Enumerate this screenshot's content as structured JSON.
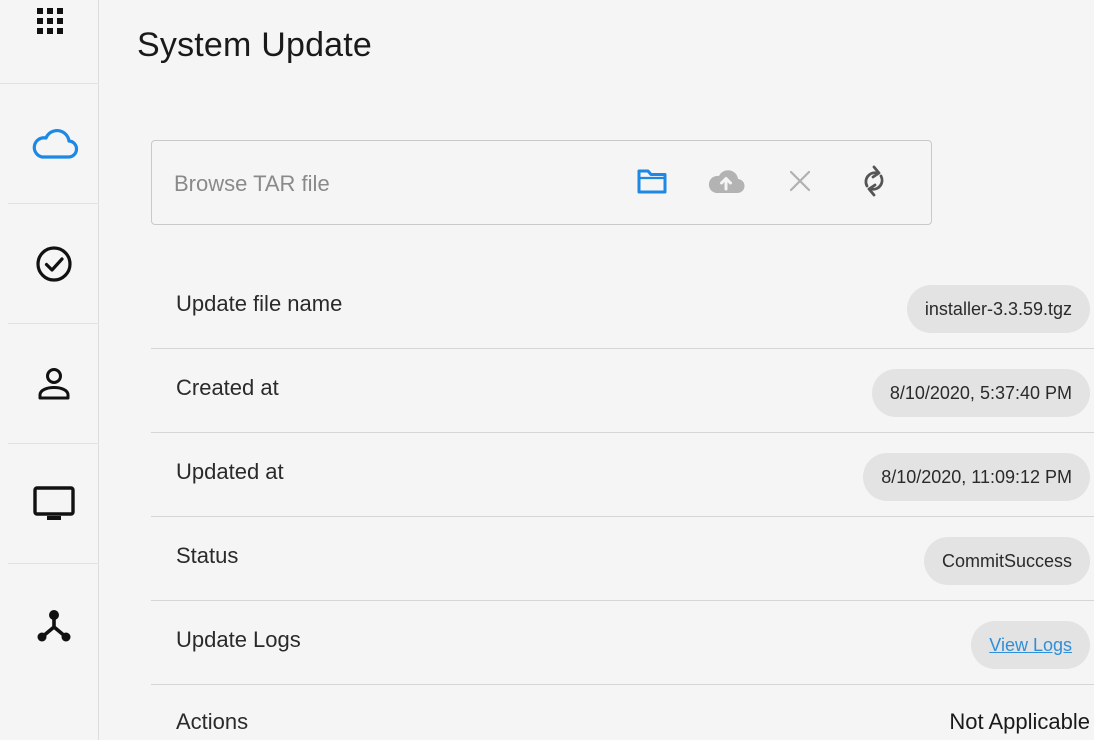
{
  "page": {
    "title": "System Update"
  },
  "sidebar": {
    "items": [
      {
        "icon": "grid-icon"
      },
      {
        "icon": "cloud-icon",
        "active": true
      },
      {
        "icon": "check-circle-icon"
      },
      {
        "icon": "person-icon"
      },
      {
        "icon": "monitor-icon"
      },
      {
        "icon": "network-icon"
      }
    ]
  },
  "upload": {
    "placeholder": "Browse TAR file",
    "icons": [
      "folder-icon",
      "cloud-upload-icon",
      "close-icon",
      "refresh-icon"
    ]
  },
  "details": {
    "file_name": {
      "label": "Update file name",
      "value": "installer-3.3.59.tgz"
    },
    "created_at": {
      "label": "Created at",
      "value": "8/10/2020, 5:37:40 PM"
    },
    "updated_at": {
      "label": "Updated at",
      "value": "8/10/2020, 11:09:12 PM"
    },
    "status": {
      "label": "Status",
      "value": "CommitSuccess"
    },
    "logs": {
      "label": "Update Logs",
      "link": "View Logs"
    },
    "actions": {
      "label": "Actions",
      "value": "Not Applicable"
    }
  },
  "colors": {
    "accent": "#1e88e5",
    "background": "#f5f5f5",
    "chip": "#e3e3e3",
    "link": "#2f8fd8"
  }
}
